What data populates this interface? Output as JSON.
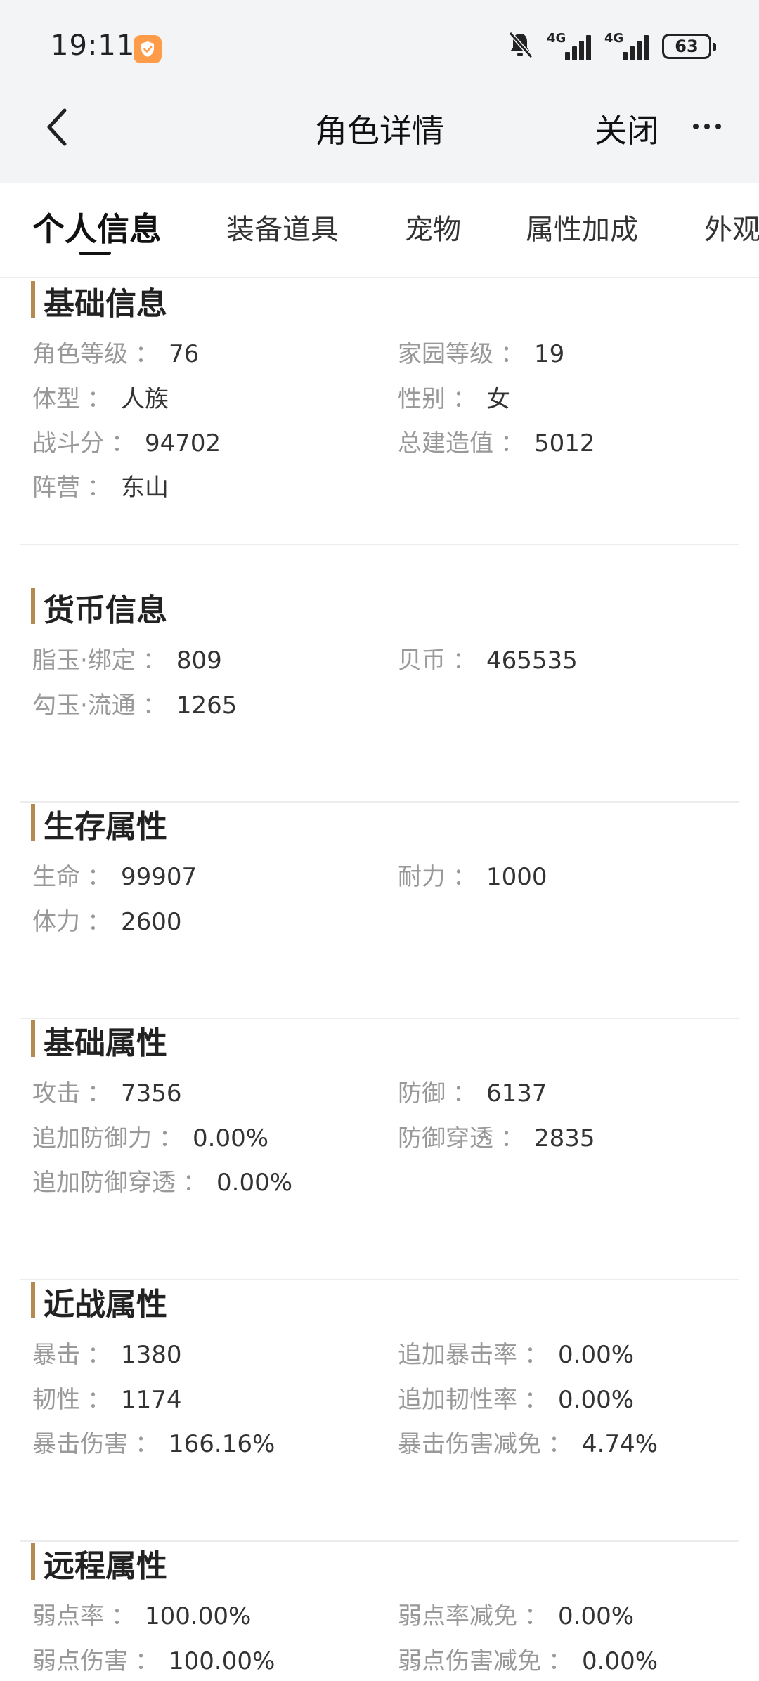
{
  "status_bar": {
    "time": "19:11",
    "net1": "4G",
    "net2": "4G",
    "battery": "63"
  },
  "nav": {
    "title": "角色详情",
    "close_label": "关闭"
  },
  "tabs": [
    "个人信息",
    "装备道具",
    "宠物",
    "属性加成",
    "外观"
  ],
  "sections": [
    {
      "title": "基础信息",
      "rows": [
        [
          {
            "k": "角色等级",
            "v": "76"
          },
          {
            "k": "家园等级",
            "v": "19"
          }
        ],
        [
          {
            "k": "体型",
            "v": "人族"
          },
          {
            "k": "性别",
            "v": "女"
          }
        ],
        [
          {
            "k": "战斗分",
            "v": "94702"
          },
          {
            "k": "总建造值",
            "v": "5012"
          }
        ],
        [
          {
            "k": "阵营",
            "v": "东山"
          }
        ]
      ]
    },
    {
      "title": "货币信息",
      "rows": [
        [
          {
            "k": "脂玉·绑定",
            "v": "809"
          },
          {
            "k": "贝币",
            "v": "465535"
          }
        ],
        [
          {
            "k": "勾玉·流通",
            "v": "1265"
          }
        ]
      ]
    },
    {
      "title": "生存属性",
      "rows": [
        [
          {
            "k": "生命",
            "v": "99907"
          },
          {
            "k": "耐力",
            "v": "1000"
          }
        ],
        [
          {
            "k": "体力",
            "v": "2600"
          }
        ]
      ]
    },
    {
      "title": "基础属性",
      "rows": [
        [
          {
            "k": "攻击",
            "v": "7356"
          },
          {
            "k": "防御",
            "v": "6137"
          }
        ],
        [
          {
            "k": "追加防御力",
            "v": "0.00%"
          },
          {
            "k": "防御穿透",
            "v": "2835"
          }
        ],
        [
          {
            "k": "追加防御穿透",
            "v": "0.00%"
          }
        ]
      ]
    },
    {
      "title": "近战属性",
      "rows": [
        [
          {
            "k": "暴击",
            "v": "1380"
          },
          {
            "k": "追加暴击率",
            "v": "0.00%"
          }
        ],
        [
          {
            "k": "韧性",
            "v": "1174"
          },
          {
            "k": "追加韧性率",
            "v": "0.00%"
          }
        ],
        [
          {
            "k": "暴击伤害",
            "v": "166.16%"
          },
          {
            "k": "暴击伤害减免",
            "v": "4.74%"
          }
        ]
      ]
    },
    {
      "title": "远程属性",
      "rows": [
        [
          {
            "k": "弱点率",
            "v": "100.00%"
          },
          {
            "k": "弱点率减免",
            "v": "0.00%"
          }
        ],
        [
          {
            "k": "弱点伤害",
            "v": "100.00%"
          },
          {
            "k": "弱点伤害减免",
            "v": "0.00%"
          }
        ]
      ]
    }
  ]
}
